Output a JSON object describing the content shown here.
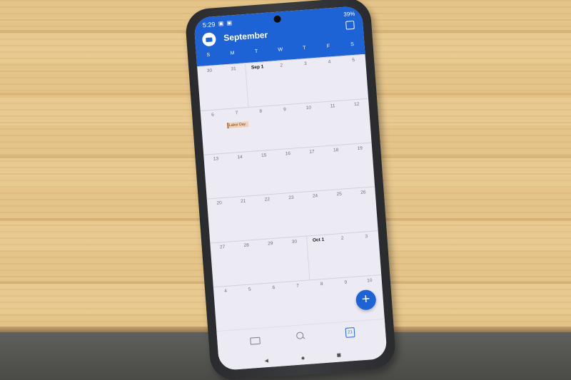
{
  "status_bar": {
    "time": "5:29",
    "icons": "▣ ▣",
    "battery": "39%"
  },
  "header": {
    "month": "September",
    "weekdays": [
      "S",
      "M",
      "T",
      "W",
      "T",
      "F",
      "S"
    ]
  },
  "weeks": [
    [
      "30",
      "31",
      "Sep 1",
      "2",
      "3",
      "4",
      "5"
    ],
    [
      "6",
      "7",
      "8",
      "9",
      "10",
      "11",
      "12"
    ],
    [
      "13",
      "14",
      "15",
      "16",
      "17",
      "18",
      "19"
    ],
    [
      "20",
      "21",
      "22",
      "23",
      "24",
      "25",
      "26"
    ],
    [
      "27",
      "28",
      "29",
      "30",
      "Oct 1",
      "2",
      "3"
    ],
    [
      "4",
      "5",
      "6",
      "7",
      "8",
      "9",
      "10"
    ]
  ],
  "event": {
    "label": "Labor Day",
    "color": "#f3d1b6",
    "accent": "#b86a3a"
  },
  "fab": {
    "label": "+"
  },
  "bottom_nav": {
    "calendar_day": "21"
  },
  "colors": {
    "accent": "#1e63d6",
    "background": "#ecebf4"
  }
}
